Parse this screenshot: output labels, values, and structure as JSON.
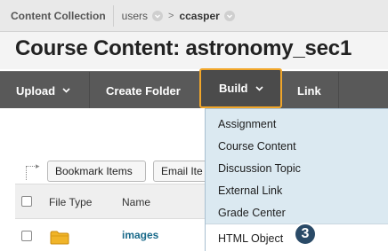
{
  "breadcrumb": {
    "root": "Content Collection",
    "users": "users",
    "separator": ">",
    "current_user": "ccasper"
  },
  "page": {
    "title": "Course Content: astronomy_sec1"
  },
  "action_bar": {
    "upload": "Upload",
    "create_folder": "Create Folder",
    "build": "Build",
    "link": "Link"
  },
  "toolbar": {
    "bookmark_items": "Bookmark Items",
    "email_items": "Email Ite"
  },
  "table": {
    "columns": [
      "File Type",
      "Name"
    ],
    "rows": [
      {
        "name": "images",
        "type_icon": "folder-icon"
      }
    ]
  },
  "build_menu": {
    "items": [
      "Assignment",
      "Course Content",
      "Discussion Topic",
      "External Link",
      "Grade Center",
      "HTML Object"
    ],
    "highlighted_index": 5
  },
  "callout": {
    "step": "3"
  },
  "colors": {
    "action_bar": "#595959",
    "build_highlight": "#f1a62a",
    "menu_bg": "#dbe9f1",
    "link": "#1a6a8a",
    "badge": "#2a4a67"
  }
}
